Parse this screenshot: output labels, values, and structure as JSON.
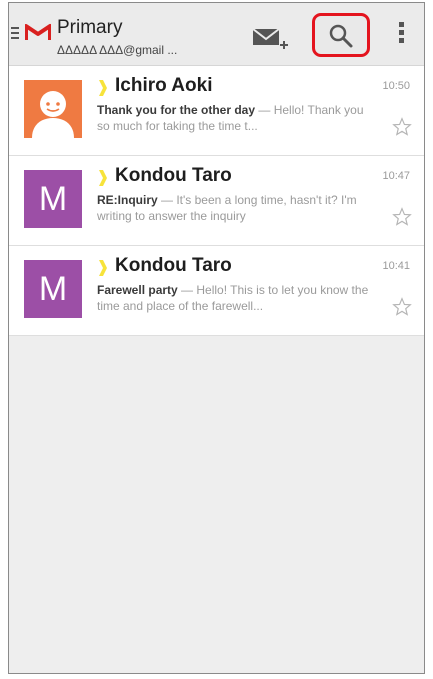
{
  "header": {
    "title": "Primary",
    "account": "ΔΔΔΔΔ ΔΔΔ@gmail ..."
  },
  "emails": [
    {
      "sender": "Ichiro Aoki",
      "time": "10:50",
      "subject": "Thank you for the other day",
      "separator": " — ",
      "snippet": "Hello! Thank you so much for taking the time t...",
      "avatar": "contact-photo",
      "starred": false
    },
    {
      "sender": "Kondou Taro",
      "time": "10:47",
      "subject": "RE:Inquiry",
      "separator": " — ",
      "snippet": "It's been a long time, hasn't it? I'm writing to answer the inquiry",
      "avatar": "M",
      "starred": false
    },
    {
      "sender": "Kondou Taro",
      "time": "10:41",
      "subject": "Farewell party",
      "separator": " — ",
      "snippet": "Hello! This is to let you know the time and place of the farewell...",
      "avatar": "M",
      "starred": false
    }
  ],
  "icons": {
    "menu": "menu-icon",
    "logo": "gmail-logo-icon",
    "compose": "compose-icon",
    "search": "search-icon",
    "overflow": "overflow-menu-icon",
    "importance": "importance-marker-icon",
    "star": "star-outline-icon"
  },
  "colors": {
    "appbar": "#ebebeb",
    "highlight": "#e4141e",
    "avatar_letter_bg": "#9c4fa6",
    "avatar_contact_bg": "#ef7a42",
    "importance": "#f7e33a",
    "logo_red": "#d9201f"
  }
}
